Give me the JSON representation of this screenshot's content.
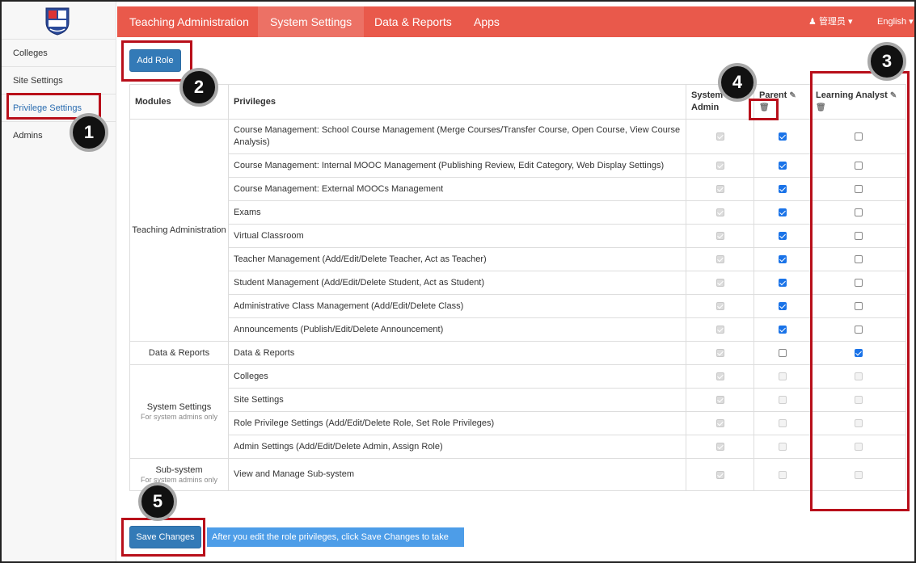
{
  "nav": {
    "items": [
      "Teaching Administration",
      "System Settings",
      "Data & Reports",
      "Apps"
    ],
    "active": 1,
    "user": "管理员",
    "language": "English"
  },
  "sidebar": {
    "items": [
      "Colleges",
      "Site Settings",
      "Privilege Settings",
      "Admins"
    ],
    "active": 2
  },
  "buttons": {
    "add_role": "Add Role",
    "save_changes": "Save Changes"
  },
  "table": {
    "headers": {
      "modules": "Modules",
      "privileges": "Privileges",
      "roles": [
        "System Admin",
        "Parent",
        "Learning Analyst"
      ]
    },
    "rows": [
      {
        "module": "Teaching Administration",
        "privilege": "Course Management: School Course Management (Merge Courses/Transfer Course, Open Course, View Course Analysis)",
        "checks": [
          1,
          1,
          0
        ],
        "disabled": [
          1,
          0,
          0
        ]
      },
      {
        "privilege": "Course Management: Internal MOOC Management (Publishing Review, Edit Category, Web Display Settings)",
        "checks": [
          1,
          1,
          0
        ],
        "disabled": [
          1,
          0,
          0
        ]
      },
      {
        "privilege": "Course Management: External MOOCs Management",
        "checks": [
          1,
          1,
          0
        ],
        "disabled": [
          1,
          0,
          0
        ]
      },
      {
        "privilege": "Exams",
        "checks": [
          1,
          1,
          0
        ],
        "disabled": [
          1,
          0,
          0
        ]
      },
      {
        "privilege": "Virtual Classroom",
        "checks": [
          1,
          1,
          0
        ],
        "disabled": [
          1,
          0,
          0
        ]
      },
      {
        "privilege": "Teacher Management (Add/Edit/Delete Teacher, Act as Teacher)",
        "checks": [
          1,
          1,
          0
        ],
        "disabled": [
          1,
          0,
          0
        ]
      },
      {
        "privilege": "Student Management (Add/Edit/Delete Student, Act as Student)",
        "checks": [
          1,
          1,
          0
        ],
        "disabled": [
          1,
          0,
          0
        ]
      },
      {
        "privilege": "Administrative Class Management (Add/Edit/Delete Class)",
        "checks": [
          1,
          1,
          0
        ],
        "disabled": [
          1,
          0,
          0
        ]
      },
      {
        "privilege": "Announcements (Publish/Edit/Delete Announcement)",
        "checks": [
          1,
          1,
          0
        ],
        "disabled": [
          1,
          0,
          0
        ]
      },
      {
        "module": "Data & Reports",
        "privilege": "Data & Reports",
        "checks": [
          1,
          0,
          1
        ],
        "disabled": [
          1,
          0,
          0
        ]
      },
      {
        "module": "System Settings",
        "module_note": "For system admins only",
        "privilege": "Colleges",
        "checks": [
          1,
          0,
          0
        ],
        "disabled": [
          1,
          1,
          1
        ]
      },
      {
        "privilege": "Site Settings",
        "checks": [
          1,
          0,
          0
        ],
        "disabled": [
          1,
          1,
          1
        ]
      },
      {
        "privilege": "Role Privilege Settings (Add/Edit/Delete Role, Set Role Privileges)",
        "checks": [
          1,
          0,
          0
        ],
        "disabled": [
          1,
          1,
          1
        ]
      },
      {
        "privilege": "Admin Settings (Add/Edit/Delete Admin, Assign Role)",
        "checks": [
          1,
          0,
          0
        ],
        "disabled": [
          1,
          1,
          1
        ]
      },
      {
        "module": "Sub-system",
        "module_note": "For system admins only",
        "privilege": "View and Manage Sub-system",
        "checks": [
          1,
          0,
          0
        ],
        "disabled": [
          1,
          1,
          1
        ]
      }
    ]
  },
  "note": "After you edit the role privileges, click Save Changes to take effect.",
  "annotations": [
    "1",
    "2",
    "3",
    "4",
    "5"
  ],
  "colors": {
    "nav": "#e9594b",
    "button": "#337ab7",
    "annotation_border": "#b80f1a",
    "note_bg": "#4d9de8"
  }
}
